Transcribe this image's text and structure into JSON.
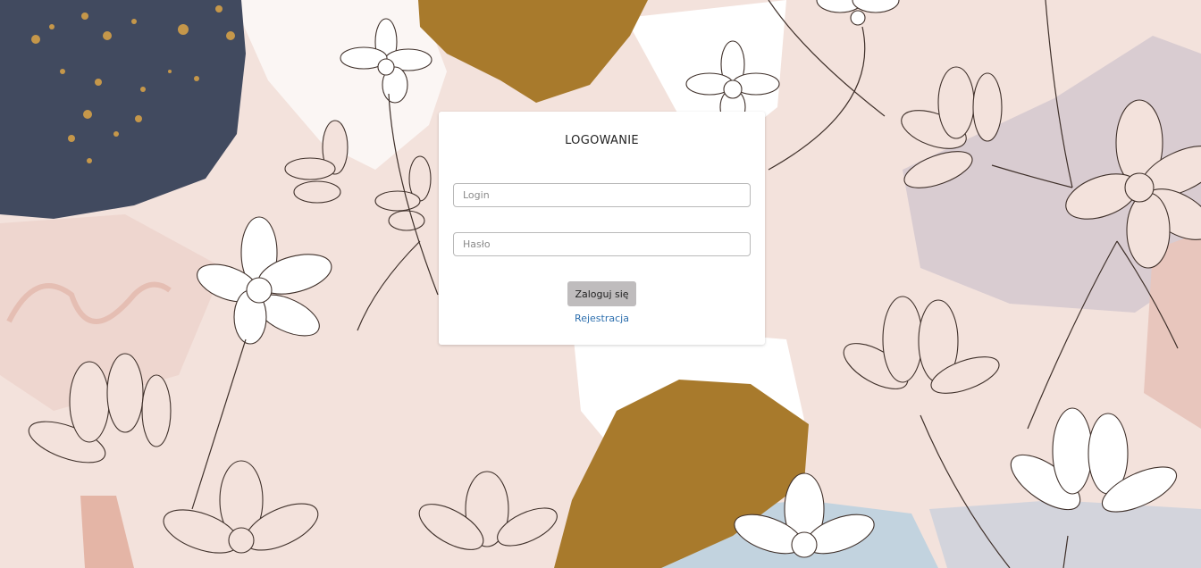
{
  "login_form": {
    "title": "LOGOWANIE",
    "login_placeholder": "Login",
    "password_placeholder": "Hasło",
    "submit_label": "Zaloguj się",
    "register_link": "Rejestracja"
  },
  "colors": {
    "background_blush": "#f3e2dc",
    "navy_blob": "#414a5f",
    "gold_accent": "#a87a2c",
    "mauve_blob": "#d9ccd1",
    "blue_blob": "#c2d3df",
    "button_grey": "#bfbcbd",
    "link_blue": "#2d6fae"
  }
}
